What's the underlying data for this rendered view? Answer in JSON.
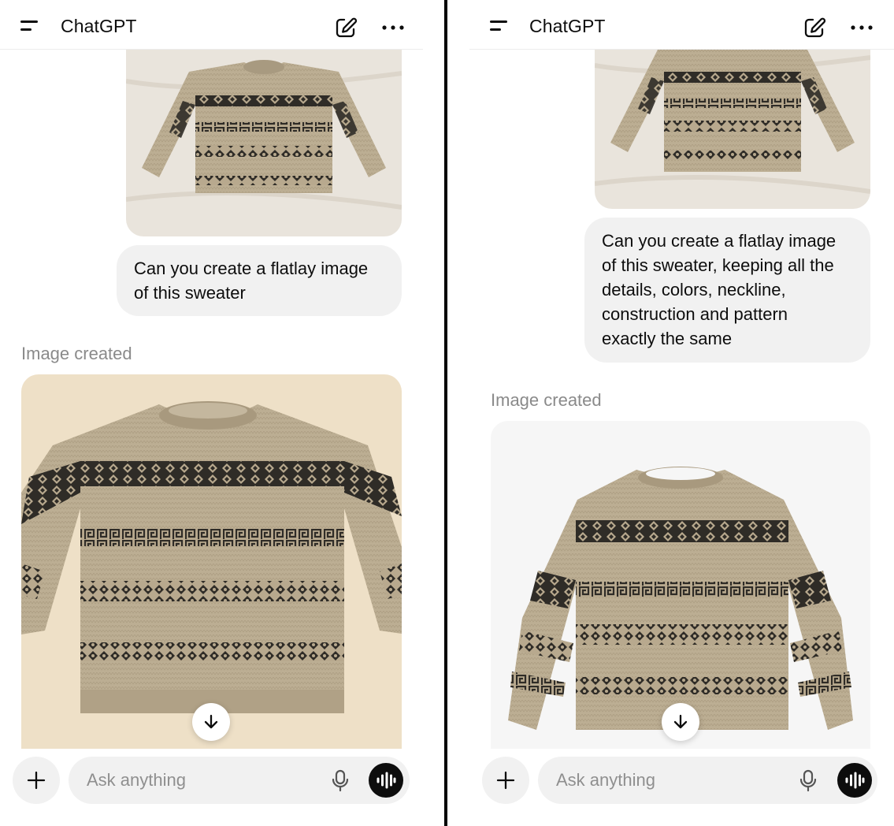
{
  "panels": [
    {
      "app_title": "ChatGPT",
      "user_message": {
        "image_name": "uploaded-sweater-photo",
        "lines": [
          "Can you create a flatlay image",
          "of this sweater"
        ]
      },
      "assistant": {
        "label": "Image created",
        "image_name": "generated-flatlay-image"
      },
      "composer": {
        "placeholder": "Ask anything"
      }
    },
    {
      "app_title": "ChatGPT",
      "user_message": {
        "image_name": "uploaded-sweater-photo",
        "lines": [
          "Can you create a flatlay image",
          "of this sweater, keeping all the",
          "details, colors, neckline,",
          "construction and pattern",
          "exactly the same"
        ]
      },
      "assistant": {
        "label": "Image created",
        "image_name": "generated-flatlay-image"
      },
      "composer": {
        "placeholder": "Ask anything"
      }
    }
  ],
  "colors": {
    "bubble_bg": "#f1f1f1",
    "sweater_knit": "#b8a98e",
    "sweater_pattern": "#2f2c27",
    "bed_sheet": "#e9e4dc",
    "flatlay_bg_left": "#eee0c7",
    "flatlay_bg_right": "#f6f6f6"
  },
  "icons": [
    "menu-icon",
    "edit-icon",
    "more-icon",
    "arrow-down-icon",
    "plus-icon",
    "mic-icon",
    "voice-mode-icon"
  ]
}
